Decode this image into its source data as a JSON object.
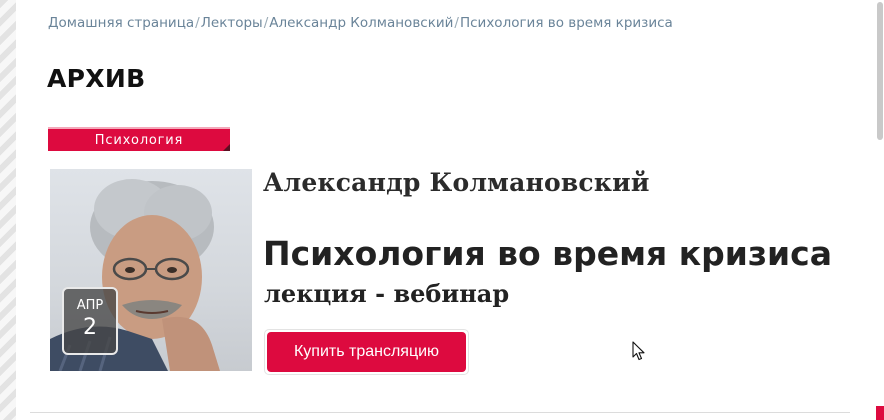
{
  "breadcrumb": {
    "items": [
      {
        "label": "Домашняя страница"
      },
      {
        "label": "Лекторы"
      },
      {
        "label": "Александр Колмановский"
      },
      {
        "label": "Психология во время кризиса"
      }
    ],
    "separator": "/"
  },
  "page": {
    "title": "АРХИВ"
  },
  "event": {
    "category": "Психология",
    "date": {
      "month": "АПР",
      "day": "2"
    },
    "author": "Александр Колмановский",
    "title": "Психология во время кризиса",
    "subtitle": "лекция - вебинар",
    "buy_label": "Купить трансляцию"
  },
  "colors": {
    "accent": "#dd0a3f",
    "link": "#6a8499",
    "text": "#222222"
  },
  "icons": {
    "cursor": "mouse-pointer-icon"
  }
}
